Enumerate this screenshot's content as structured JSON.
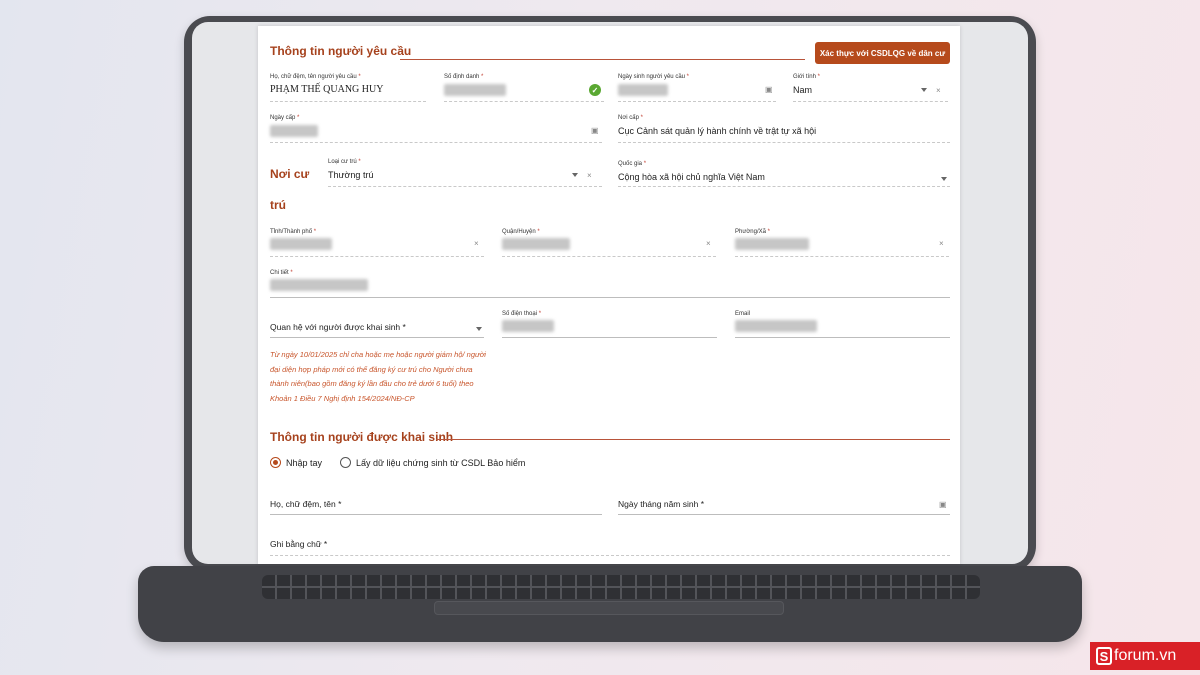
{
  "requester": {
    "section_title": "Thông tin người yêu cầu",
    "verify_button": "Xác thực với CSDLQG về dân cư",
    "full_name_label": "Họ, chữ đệm, tên người yêu cầu",
    "full_name_value": "PHẠM THẾ QUANG HUY",
    "id_number_label": "Số định danh",
    "birth_date_label": "Ngày sinh người yêu cầu",
    "gender_label": "Giới tính",
    "gender_value": "Nam",
    "issue_date_label": "Ngày cấp",
    "issue_place_label": "Nơi cấp",
    "issue_place_value": "Cục Cảnh sát quản lý hành chính về trật tự xã hội"
  },
  "residence": {
    "section_title_line1": "Nơi cư",
    "section_title_line2": "trú",
    "type_label": "Loại cư trú",
    "type_value": "Thường trú",
    "country_label": "Quốc gia",
    "country_value": "Cộng hòa xã hội chủ nghĩa Việt Nam",
    "province_label": "Tỉnh/Thành phố",
    "district_label": "Quận/Huyện",
    "ward_label": "Phường/Xã",
    "detail_label": "Chi tiết"
  },
  "contact": {
    "relationship_label": "Quan hệ với người được khai sinh",
    "phone_label": "Số điện thoại",
    "email_label": "Email",
    "note": "Từ ngày 10/01/2025 chỉ cha hoặc mẹ hoặc người giám hộ/ người đại diện hợp pháp mới có thể đăng ký cư trú cho Người chưa thành niên(bao gồm đăng ký lần đầu cho trẻ dưới 6 tuổi) theo Khoản 1 Điều 7 Nghị định 154/2024/NĐ-CP"
  },
  "registrant": {
    "section_title": "Thông tin người được khai sinh",
    "radio_manual": "Nhập tay",
    "radio_insurance": "Lấy dữ liệu chứng sinh từ CSDL Bảo hiểm",
    "name_label": "Họ, chữ đệm, tên",
    "dob_label": "Ngày tháng năm sinh",
    "words_label": "Ghi bằng chữ"
  },
  "watermark": {
    "s": "S",
    "text": "forum.vn"
  },
  "required_mark": "*"
}
